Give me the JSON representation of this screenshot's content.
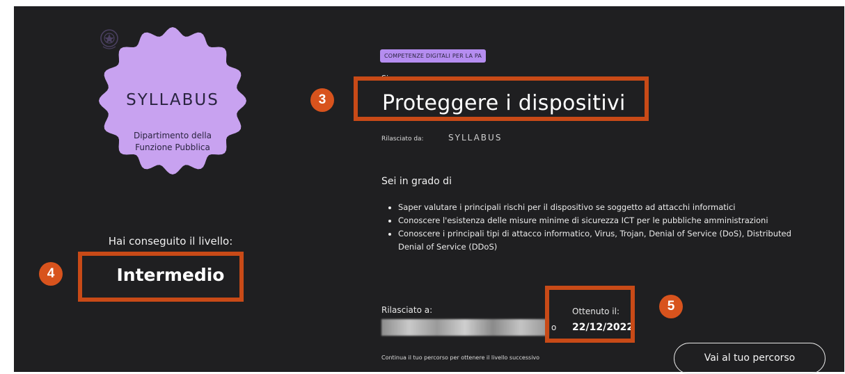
{
  "badge": {
    "brand": "SYLLABUS",
    "dept_line1": "Dipartimento della",
    "dept_line2": "Funzione Pubblica",
    "badge_color": "#c8a2f0",
    "emblem_icon": "italian-republic-emblem-icon"
  },
  "level": {
    "label": "Hai conseguito il livello:",
    "value": "Intermedio"
  },
  "course": {
    "tag": "COMPETENZE DIGITALI PER LA PA",
    "category": "Sicurezza",
    "title": "Proteggere i dispositivi",
    "issued_by_label": "Rilasciato da:",
    "issued_by_logo": "SYLLABUS"
  },
  "abilities": {
    "title": "Sei in grado di",
    "items": [
      "Saper valutare i principali rischi per il dispositivo se soggetto ad attacchi informatici",
      "Conoscere l'esistenza delle misure minime di sicurezza ICT per le pubbliche amministrazioni",
      "Conoscere i principali tipi di attacco informatico, Virus, Trojan, Denial of Service (DoS), Distributed Denial of Service (DDoS)"
    ]
  },
  "recipient": {
    "label": "Rilasciato a:",
    "tail": "o"
  },
  "obtained": {
    "label": "Ottenuto il:",
    "date": "22/12/2022"
  },
  "footer": {
    "continue_text": "Continua il tuo percorso per ottenere il livello successivo",
    "button_label": "Vai al tuo percorso"
  },
  "annotations": {
    "marker_title": "3",
    "marker_level": "4",
    "marker_date": "5",
    "highlight_color": "#c84a17",
    "marker_color": "#d8531d"
  },
  "colors": {
    "card_background": "#1f1f21",
    "tag_background": "#b58df0"
  }
}
